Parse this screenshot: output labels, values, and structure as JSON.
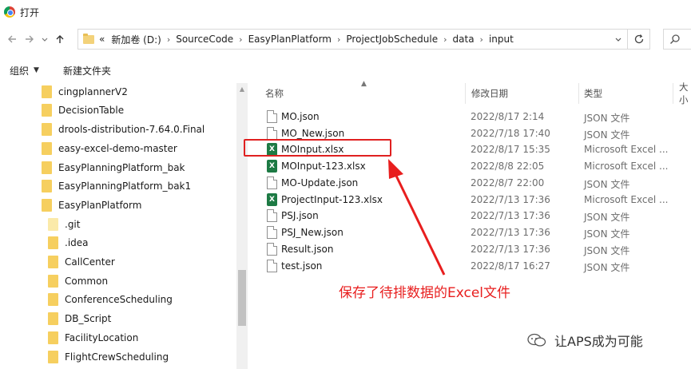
{
  "window": {
    "title": "打开",
    "app_icon": "chrome-icon"
  },
  "navigation": {
    "back_icon": "back-arrow-icon",
    "forward_icon": "forward-arrow-icon",
    "recent_icon": "chevron-down-icon",
    "up_icon": "up-arrow-icon"
  },
  "address": {
    "overflow": "«",
    "separator": "›",
    "crumbs": [
      "新加卷 (D:)",
      "SourceCode",
      "EasyPlanPlatform",
      "ProjectJobSchedule",
      "data",
      "input"
    ]
  },
  "toolbar": {
    "organize_label": "组织",
    "new_folder_label": "新建文件夹"
  },
  "nav_tree": [
    {
      "label": "cingplannerV2"
    },
    {
      "label": "DecisionTable"
    },
    {
      "label": "drools-distribution-7.64.0.Final"
    },
    {
      "label": "easy-excel-demo-master"
    },
    {
      "label": "EasyPlanningPlatform_bak"
    },
    {
      "label": "EasyPlanningPlatform_bak1"
    },
    {
      "label": "EasyPlanPlatform"
    },
    {
      "label": ".git"
    },
    {
      "label": ".idea"
    },
    {
      "label": "CallCenter"
    },
    {
      "label": "Common"
    },
    {
      "label": "ConferenceScheduling"
    },
    {
      "label": "DB_Script"
    },
    {
      "label": "FacilityLocation"
    },
    {
      "label": "FlightCrewScheduling"
    }
  ],
  "columns": {
    "name": "名称",
    "modified": "修改日期",
    "type": "类型",
    "size": "大小"
  },
  "files": [
    {
      "name": "MO.json",
      "date": "2022/8/17 2:14",
      "type": "JSON 文件",
      "kind": "json"
    },
    {
      "name": "MO_New.json",
      "date": "2022/7/18 17:40",
      "type": "JSON 文件",
      "kind": "json"
    },
    {
      "name": "MOInput.xlsx",
      "date": "2022/8/17 15:35",
      "type": "Microsoft Excel ...",
      "kind": "xlsx"
    },
    {
      "name": "MOInput-123.xlsx",
      "date": "2022/8/8 22:05",
      "type": "Microsoft Excel ...",
      "kind": "xlsx"
    },
    {
      "name": "MO-Update.json",
      "date": "2022/8/7 22:00",
      "type": "JSON 文件",
      "kind": "json"
    },
    {
      "name": "ProjectInput-123.xlsx",
      "date": "2022/7/13 17:36",
      "type": "Microsoft Excel ...",
      "kind": "xlsx"
    },
    {
      "name": "PSJ.json",
      "date": "2022/7/13 17:36",
      "type": "JSON 文件",
      "kind": "json"
    },
    {
      "name": "PSJ_New.json",
      "date": "2022/7/13 17:36",
      "type": "JSON 文件",
      "kind": "json"
    },
    {
      "name": "Result.json",
      "date": "2022/7/13 17:36",
      "type": "JSON 文件",
      "kind": "json"
    },
    {
      "name": "test.json",
      "date": "2022/8/17 16:27",
      "type": "JSON 文件",
      "kind": "json"
    }
  ],
  "annotation": {
    "text": "保存了待排数据的Excel文件",
    "color": "#e81e1e"
  },
  "watermark": {
    "text": "让APS成为可能"
  },
  "excel_icon_letter": "X"
}
